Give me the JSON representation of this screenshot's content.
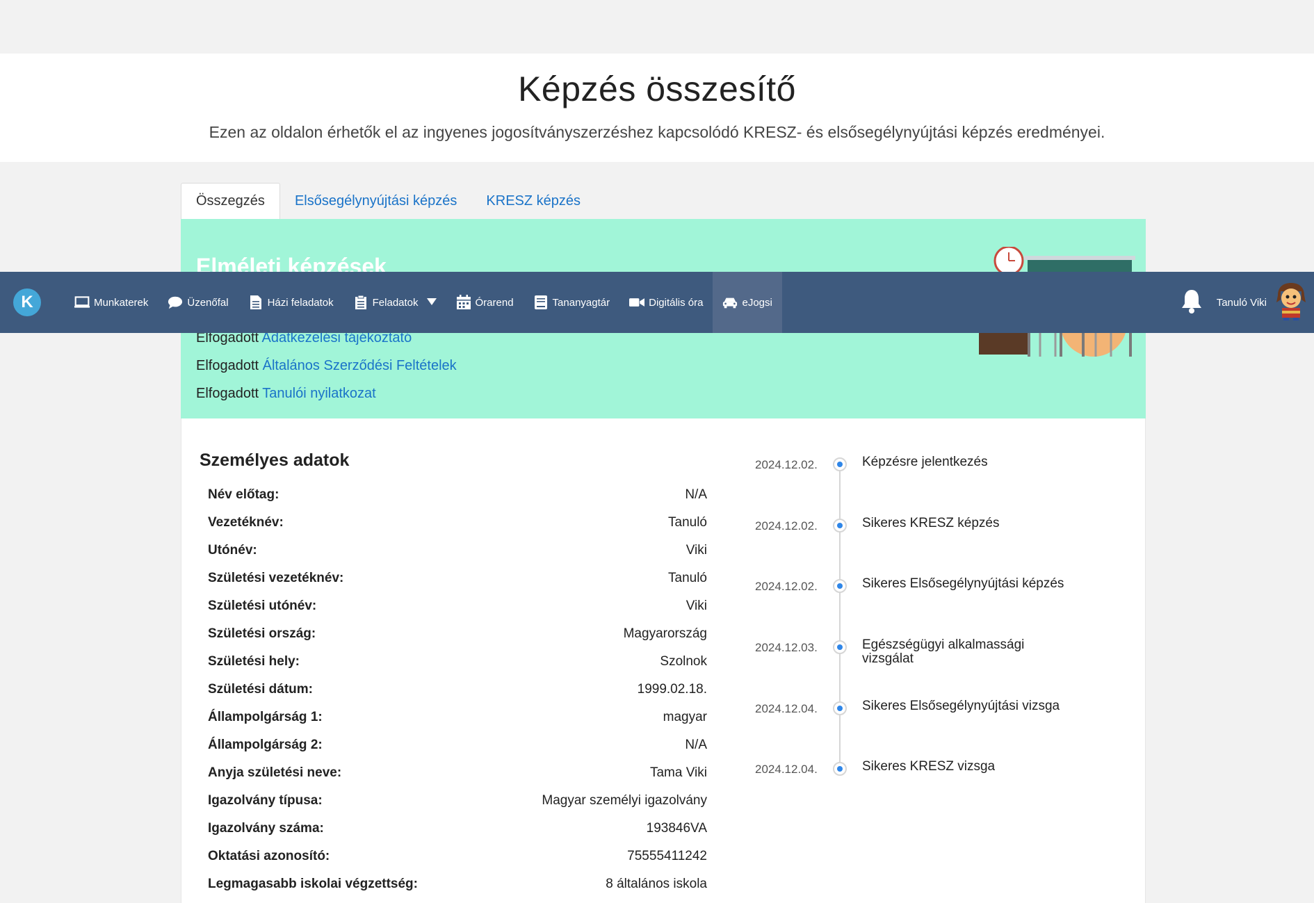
{
  "header": {
    "title": "Képzés összesítő",
    "subtitle": "Ezen az oldalon érhetők el az ingyenes jogosítványszerzéshez kapcsolódó KRESZ- és elsősegélynyújtási képzés eredményei."
  },
  "tabs": [
    {
      "label": "Összegzés"
    },
    {
      "label": "Elsősegélynyújtási képzés"
    },
    {
      "label": "KRESZ képzés"
    }
  ],
  "banner": {
    "title": "Elméleti képzések",
    "consents": [
      {
        "prefix": "Elfogadott",
        "link": "Adatkezelési tájékoztató"
      },
      {
        "prefix": "Elfogadott",
        "link": "Általános Szerződési Feltételek"
      },
      {
        "prefix": "Elfogadott",
        "link": "Tanulói nyilatkozat"
      }
    ]
  },
  "navbar": {
    "logo": "K",
    "items": [
      {
        "label": "Munkaterek",
        "icon": "monitor-icon"
      },
      {
        "label": "Üzenőfal",
        "icon": "speech-bubble-icon"
      },
      {
        "label": "Házi feladatok",
        "icon": "document-icon"
      },
      {
        "label": "Feladatok",
        "icon": "clipboard-icon"
      },
      {
        "label": "Órarend",
        "icon": "calendar-icon"
      },
      {
        "label": "Tananyagtár",
        "icon": "book-icon"
      },
      {
        "label": "Digitális óra",
        "icon": "video-camera-icon"
      },
      {
        "label": "eJogsi",
        "icon": "car-icon"
      }
    ],
    "user": "Tanuló Viki"
  },
  "personal": {
    "title": "Személyes adatok",
    "rows": [
      {
        "label": "Név előtag:",
        "value": "N/A"
      },
      {
        "label": "Vezetéknév:",
        "value": "Tanuló"
      },
      {
        "label": "Utónév:",
        "value": "Viki"
      },
      {
        "label": "Születési vezetéknév:",
        "value": "Tanuló"
      },
      {
        "label": "Születési utónév:",
        "value": "Viki"
      },
      {
        "label": "Születési ország:",
        "value": "Magyarország"
      },
      {
        "label": "Születési hely:",
        "value": "Szolnok"
      },
      {
        "label": "Születési dátum:",
        "value": "1999.02.18."
      },
      {
        "label": "Állampolgárság 1:",
        "value": "magyar"
      },
      {
        "label": "Állampolgárság 2:",
        "value": "N/A"
      },
      {
        "label": "Anyja születési neve:",
        "value": "Tama Viki"
      },
      {
        "label": "Igazolvány típusa:",
        "value": "Magyar személyi igazolvány"
      },
      {
        "label": "Igazolvány száma:",
        "value": "193846VA"
      },
      {
        "label": "Oktatási azonosító:",
        "value": "75555411242"
      },
      {
        "label": "Legmagasabb iskolai végzettség:",
        "value": "8 általános iskola"
      }
    ]
  },
  "timeline": [
    {
      "date": "2024.12.02.",
      "text": "Képzésre jelentkezés"
    },
    {
      "date": "2024.12.02.",
      "text": "Sikeres KRESZ képzés"
    },
    {
      "date": "2024.12.02.",
      "text": "Sikeres Elsősegélynyújtási képzés"
    },
    {
      "date": "2024.12.03.",
      "text": "Egészségügyi alkalmassági vizsgálat"
    },
    {
      "date": "2024.12.04.",
      "text": "Sikeres Elsősegélynyújtási vizsga"
    },
    {
      "date": "2024.12.04.",
      "text": "Sikeres KRESZ vizsga"
    }
  ]
}
